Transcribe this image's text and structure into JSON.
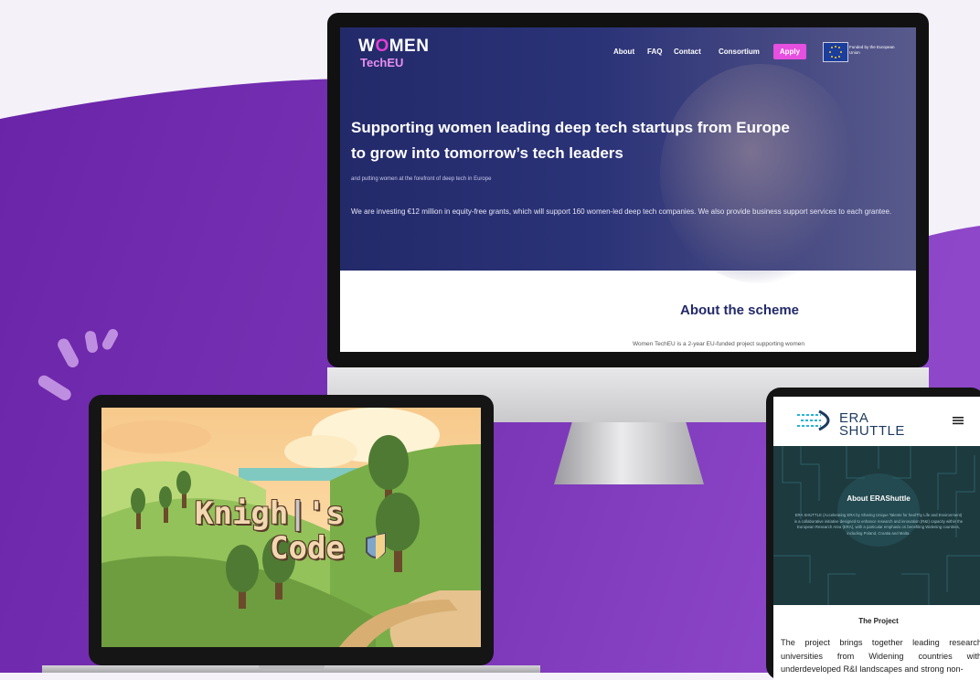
{
  "colors": {
    "bg_purple": "#6a2db0",
    "bg_purple_light": "#8a45c8",
    "women_navy": "#232a6a",
    "women_pink": "#e64fe0",
    "era_navy": "#1e3a5f",
    "era_circuit": "#1d3a3f"
  },
  "women_tech": {
    "logo_line1_a": "W",
    "logo_line1_o": "O",
    "logo_line1_b": "MEN",
    "logo_line2": "TechEU",
    "nav": [
      "About",
      "FAQ",
      "Contact",
      "Consortium"
    ],
    "apply_label": "Apply",
    "eu_label": "Funded by the European Union",
    "headline_1": "Supporting women leading deep tech startups from Europe",
    "headline_2": "to grow into tomorrow’s tech leaders",
    "subheadline": "and putting women at the forefront of deep tech in Europe",
    "paragraph": "We are investing €12 million in equity-free grants, which will support 160 women-led deep tech companies. We also provide business support services to each grantee.",
    "about_title": "About the scheme",
    "about_text": "Women TechEU is a 2-year EU-funded project supporting women"
  },
  "game": {
    "title_line1": "Knigh",
    "title_line1_end": "'s",
    "title_line2": "Code"
  },
  "era": {
    "logo_line1": "ERA",
    "logo_line2": "SHUTTLE",
    "about_title": "About ERAShuttle",
    "about_text": "ERA SHUTTLE (Accelerating ERA by Sharing Unique Talents for healThy Life and Environment) is a collaborative initiative designed to enhance research and innovation (R&I) capacity within the European Research Area (ERA), with a particular emphasis on benefiting Widening countries, including Poland, Croatia and Malta.",
    "project_title": "The Project",
    "project_text": "The project brings together leading research universities from Widening countries with underdeveloped R&I landscapes and strong non-"
  }
}
